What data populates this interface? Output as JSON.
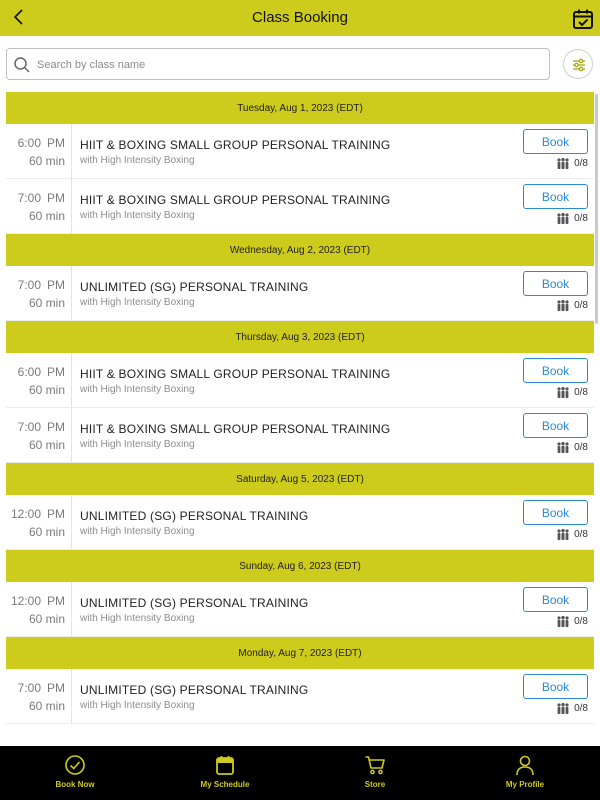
{
  "header": {
    "title": "Class Booking"
  },
  "search": {
    "placeholder": "Search by class name"
  },
  "colors": {
    "accent": "#cdcb1c",
    "book_blue": "#2a8ad8"
  },
  "icons": {
    "back": "chevron-left-icon",
    "calendar": "calendar-check-icon",
    "search": "search-icon",
    "filter": "sliders-icon",
    "capacity": "people-icon"
  },
  "days": [
    {
      "date": "Tuesday, Aug 1, 2023 (EDT)",
      "sessions": [
        {
          "time": "6:00",
          "ampm": "PM",
          "duration": "60 min",
          "name": "HIIT & BOXING SMALL GROUP PERSONAL TRAINING",
          "studio": "with High Intensity Boxing",
          "book_label": "Book",
          "capacity": "0/8"
        },
        {
          "time": "7:00",
          "ampm": "PM",
          "duration": "60 min",
          "name": "HIIT & BOXING SMALL GROUP PERSONAL TRAINING",
          "studio": "with High Intensity Boxing",
          "book_label": "Book",
          "capacity": "0/8"
        }
      ]
    },
    {
      "date": "Wednesday, Aug 2, 2023 (EDT)",
      "sessions": [
        {
          "time": "7:00",
          "ampm": "PM",
          "duration": "60 min",
          "name": "UNLIMITED (SG) PERSONAL TRAINING",
          "studio": "with High Intensity Boxing",
          "book_label": "Book",
          "capacity": "0/8"
        }
      ]
    },
    {
      "date": "Thursday, Aug 3, 2023 (EDT)",
      "sessions": [
        {
          "time": "6:00",
          "ampm": "PM",
          "duration": "60 min",
          "name": "HIIT & BOXING SMALL GROUP PERSONAL TRAINING",
          "studio": "with High Intensity Boxing",
          "book_label": "Book",
          "capacity": "0/8"
        },
        {
          "time": "7:00",
          "ampm": "PM",
          "duration": "60 min",
          "name": "HIIT & BOXING SMALL GROUP PERSONAL TRAINING",
          "studio": "with High Intensity Boxing",
          "book_label": "Book",
          "capacity": "0/8"
        }
      ]
    },
    {
      "date": "Saturday, Aug 5, 2023 (EDT)",
      "sessions": [
        {
          "time": "12:00",
          "ampm": "PM",
          "duration": "60 min",
          "name": "UNLIMITED (SG) PERSONAL TRAINING",
          "studio": "with High Intensity Boxing",
          "book_label": "Book",
          "capacity": "0/8"
        }
      ]
    },
    {
      "date": "Sunday, Aug 6, 2023 (EDT)",
      "sessions": [
        {
          "time": "12:00",
          "ampm": "PM",
          "duration": "60 min",
          "name": "UNLIMITED (SG) PERSONAL TRAINING",
          "studio": "with High Intensity Boxing",
          "book_label": "Book",
          "capacity": "0/8"
        }
      ]
    },
    {
      "date": "Monday, Aug 7, 2023 (EDT)",
      "sessions": [
        {
          "time": "7:00",
          "ampm": "PM",
          "duration": "60 min",
          "name": "UNLIMITED (SG) PERSONAL TRAINING",
          "studio": "with High Intensity Boxing",
          "book_label": "Book",
          "capacity": "0/8"
        }
      ]
    }
  ],
  "nav": [
    {
      "label": "Book Now",
      "icon": "check-circle-icon"
    },
    {
      "label": "My Schedule",
      "icon": "calendar-icon"
    },
    {
      "label": "Store",
      "icon": "cart-icon"
    },
    {
      "label": "My Profile",
      "icon": "user-icon"
    }
  ]
}
